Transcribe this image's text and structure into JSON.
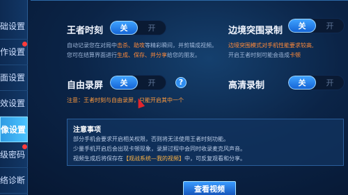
{
  "sidebar": {
    "items": [
      {
        "label": "础设置",
        "dot": false,
        "active": false
      },
      {
        "label": "作设置",
        "dot": true,
        "active": false
      },
      {
        "label": "面设置",
        "dot": false,
        "active": false
      },
      {
        "label": "效设置",
        "dot": false,
        "active": false
      },
      {
        "label": "像设置",
        "dot": false,
        "active": true
      },
      {
        "label": "级密码",
        "dot": true,
        "active": false
      },
      {
        "label": "络诊断",
        "dot": false,
        "active": false
      }
    ]
  },
  "settings": {
    "highlight": {
      "label": "王者时刻",
      "on": "关",
      "off": "开",
      "desc_line1_pre": "自动记录您在对局中",
      "desc_line1_hl": "击杀、助攻",
      "desc_line1_post": "等精彩瞬间，并剪辑成视频。",
      "desc_line2_pre": "您可在结算界面进行",
      "desc_line2_hl": "生成、保存、并分享",
      "desc_line2_post": "给您的朋友。"
    },
    "border_record": {
      "label": "边境突围录制",
      "on": "关",
      "off": "开",
      "desc_line1": "边境突围模式对手机性能要求较高,",
      "desc_line2_pre": "开启王者时刻可能会造成",
      "desc_line2_hl": "卡顿"
    },
    "free_record": {
      "label": "自由录屏",
      "on": "关",
      "off": "开",
      "help": "?"
    },
    "hd_record": {
      "label": "高清录制",
      "on": "关",
      "off": "开"
    },
    "notice": "注意：王者时刻与自由录屏，只能开启其中一个"
  },
  "note_box": {
    "title": "注意事项",
    "line1": "部分手机会要求开启相关权限，否则将无法使用王者时刻功能。",
    "line2": "少量手机开启后会出现卡顿现象，录屏过程中会同时收录麦克风声音。",
    "line3_pre": "视频生成后将保存在",
    "line3_link": "【观战系统—我的视频】",
    "line3_post": "中，可反复观看和分享。"
  },
  "view_button": "查看视频",
  "colors": {
    "accent": "#2f8df0",
    "highlight": "#ff8a3a",
    "active_tab": "#4bc3ff"
  }
}
